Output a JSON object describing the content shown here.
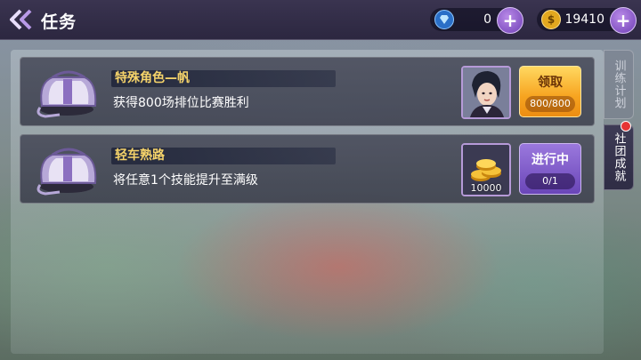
{
  "header": {
    "title": "任务",
    "back_icon": "double-chevron-left-icon"
  },
  "currency": {
    "diamond": {
      "icon": "diamond-icon",
      "value": "0"
    },
    "coin": {
      "icon": "dollar-coin-icon",
      "symbol": "$",
      "value": "19410"
    }
  },
  "tasks": [
    {
      "name": "特殊角色—帆",
      "description": "获得800场排位比赛胜利",
      "reward": "character-portrait",
      "button": {
        "label": "领取",
        "progress": "800/800",
        "state": "claim"
      }
    },
    {
      "name": "轻车熟路",
      "description": "将任意1个技能提升至满级",
      "reward_count": "10000",
      "button": {
        "label": "进行中",
        "progress": "0/1",
        "state": "in-progress"
      }
    }
  ],
  "side_tabs": [
    {
      "label": "训练计划",
      "active": false
    },
    {
      "label": "社团成就",
      "active": true,
      "badge": true
    }
  ],
  "colors": {
    "accent_purple": "#6f3fb5",
    "claim_orange": "#f7a420",
    "task_name_gold": "#f5d36a",
    "badge_red": "#e63434"
  }
}
